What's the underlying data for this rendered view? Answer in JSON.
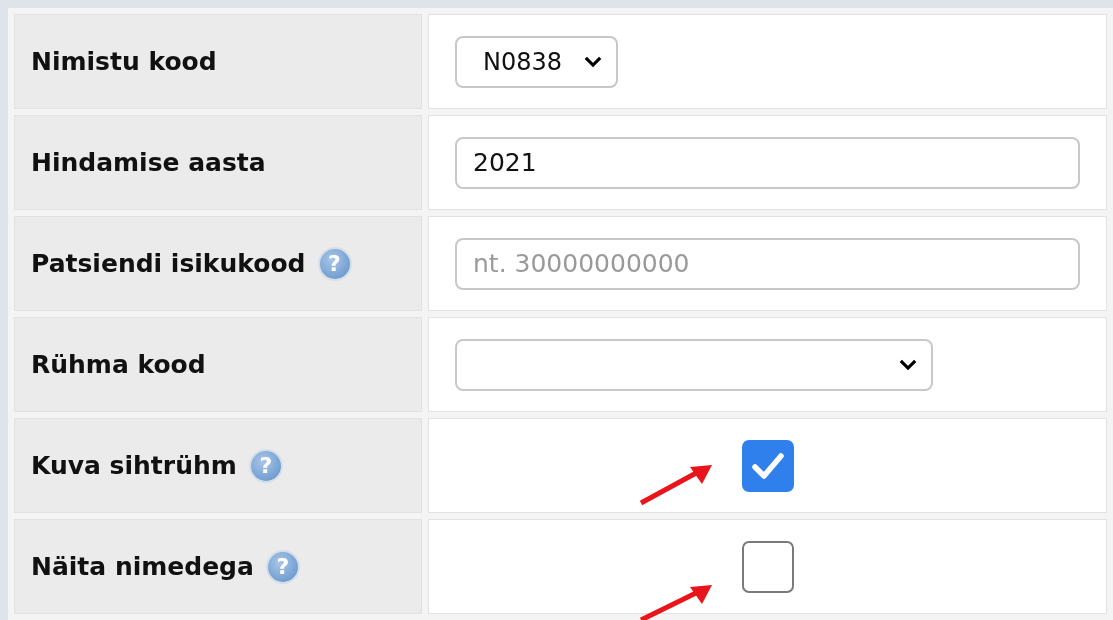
{
  "rows": [
    {
      "label": "Nimistu kood",
      "kind": "select",
      "value": "N0838"
    },
    {
      "label": "Hindamise aasta",
      "kind": "text",
      "value": "2021"
    },
    {
      "label": "Patsiendi isikukood",
      "help": "?",
      "kind": "text",
      "placeholder": "nt. 30000000000"
    },
    {
      "label": "Rühma kood",
      "kind": "select",
      "value": ""
    },
    {
      "label": "Kuva sihtrühm",
      "help": "?",
      "kind": "checkbox",
      "checked": true
    },
    {
      "label": "Näita nimedega",
      "help": "?",
      "kind": "checkbox",
      "checked": false
    }
  ]
}
